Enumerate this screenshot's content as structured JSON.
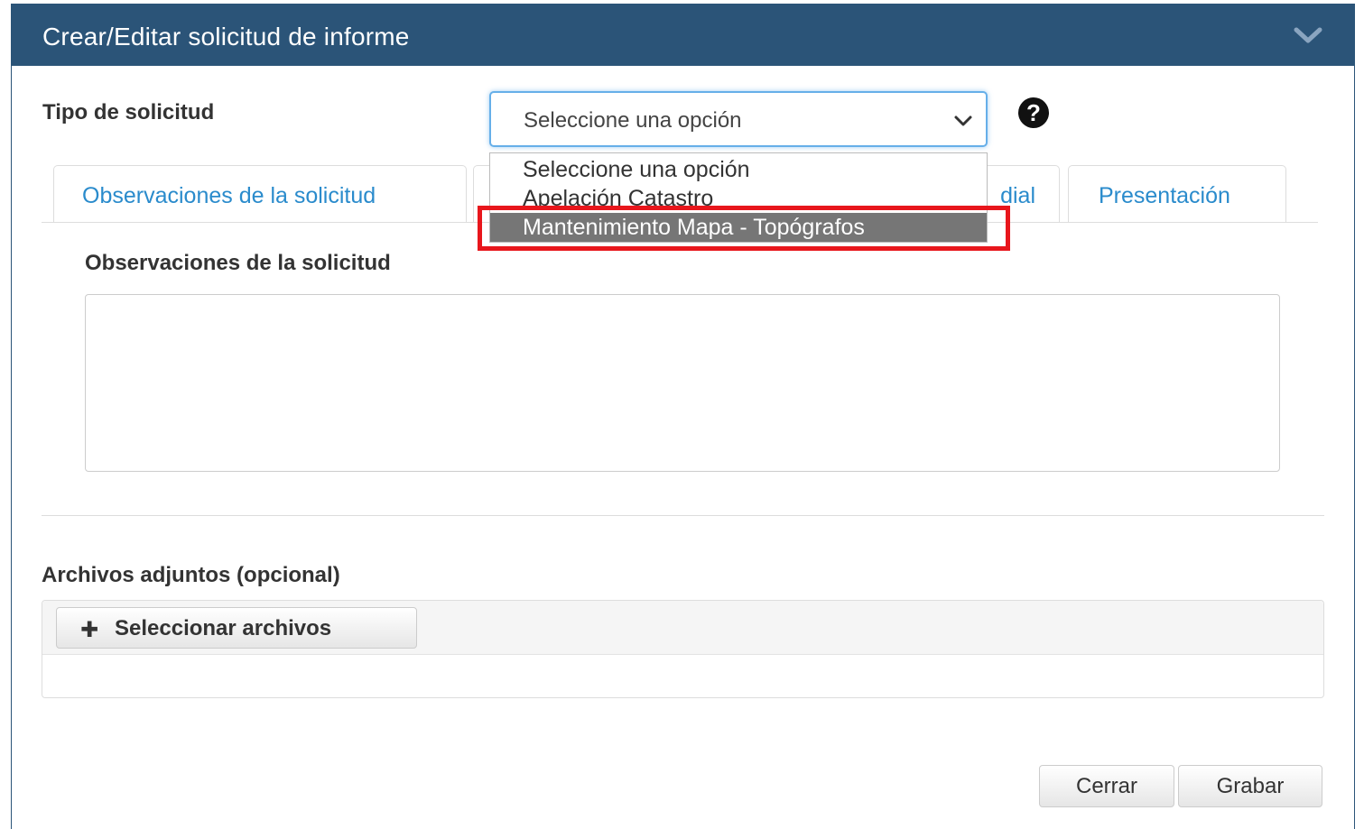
{
  "header": {
    "title": "Crear/Editar solicitud de informe",
    "collapse_icon": "chevron-down-icon"
  },
  "form": {
    "tipo_label": "Tipo de solicitud",
    "select_value": "Seleccione una opción",
    "options": [
      "Seleccione una opción",
      "Apelación Catastro",
      "Mantenimiento Mapa - Topógrafos"
    ],
    "highlighted_option": "Mantenimiento Mapa - Topógrafos",
    "help_icon": "question-circle-icon"
  },
  "tabs": [
    {
      "label": "Observaciones de la solicitud",
      "active": true
    },
    {
      "label": "dial",
      "active": false
    },
    {
      "label": "Presentación",
      "active": false
    }
  ],
  "observaciones": {
    "label": "Observaciones de la solicitud",
    "value": ""
  },
  "attachments": {
    "label": "Archivos adjuntos (opcional)",
    "button_label": "Seleccionar archivos",
    "button_icon": "plus-icon"
  },
  "footer": {
    "close_label": "Cerrar",
    "save_label": "Grabar"
  },
  "colors": {
    "header_bg": "#2b5478",
    "tab_text": "#2a8bcc",
    "highlight_border": "#e8161c",
    "selected_option_bg": "#767676"
  }
}
